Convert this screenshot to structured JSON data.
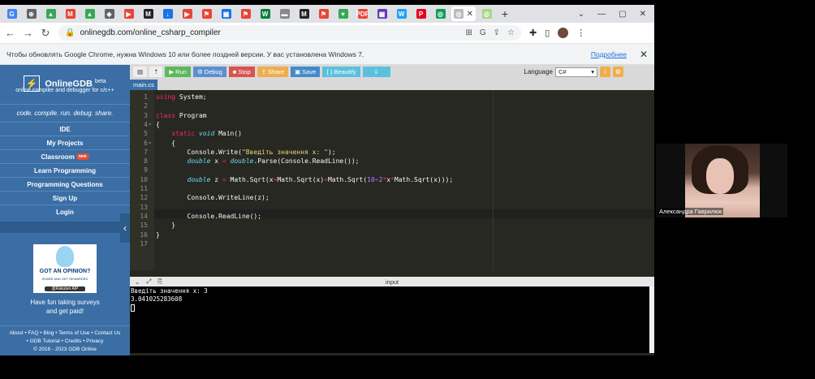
{
  "browser": {
    "tabs": [
      "G",
      "⊕",
      "▲",
      "M",
      "▲",
      "◈",
      "▶",
      "M",
      "↓",
      "▶",
      "⚑",
      "▦",
      "⚑",
      "W",
      "▬",
      "M",
      "⚑",
      "♥",
      "PDF",
      "▦",
      "W",
      "P",
      "◎"
    ],
    "active_tab_icon": "◎",
    "new_tab": "+",
    "url": "onlinegdb.com/online_csharp_compiler",
    "infobar_text": "Чтобы обновлять Google Chrome, нужна Windows 10 или более поздней версии. У вас установлена Windows 7.",
    "infobar_link": "Подробнее"
  },
  "colors": {
    "sidebar": "#3a6ea5",
    "run": "#5cb85c",
    "debug": "#5b8fd0",
    "stop": "#d9534f",
    "share": "#f0ad4e",
    "save": "#428bca",
    "editor_bg": "#272822"
  },
  "sidebar": {
    "brand": "OnlineGDB",
    "brand_sup": "beta",
    "subtitle": "online compiler and debugger for c/c++",
    "tagline": "code. compile. run. debug. share.",
    "nav": [
      {
        "label": "IDE"
      },
      {
        "label": "My Projects"
      },
      {
        "label": "Classroom",
        "badge": "new"
      },
      {
        "label": "Learn Programming"
      },
      {
        "label": "Programming Questions"
      },
      {
        "label": "Sign Up"
      },
      {
        "label": "Login"
      }
    ],
    "ad": {
      "headline": "GOT AN OPINION?",
      "sub": "SHARE AND GET REWARDED",
      "brand": "@Rakuten AIP"
    },
    "ad_caption_1": "Have fun taking surveys",
    "ad_caption_2": "and get paid!",
    "footer_1": "About • FAQ • Blog • Terms of Use • Contact Us",
    "footer_2": "• GDB Tutorial • Credits • Privacy",
    "footer_3": "© 2016 - 2023 GDB Online"
  },
  "toolbar": {
    "run": "Run",
    "debug": "Debug",
    "stop": "Stop",
    "share": "Share",
    "save": "Save",
    "beautify": "{ } Beautify",
    "language_label": "Language",
    "language_value": "C#"
  },
  "file_tab": "main.cs",
  "io": {
    "title": "input",
    "console_lines": [
      "Введіть значення x: 3",
      "3.041025283608"
    ]
  },
  "video": {
    "participant_name": "Александра Гаврилюк"
  }
}
